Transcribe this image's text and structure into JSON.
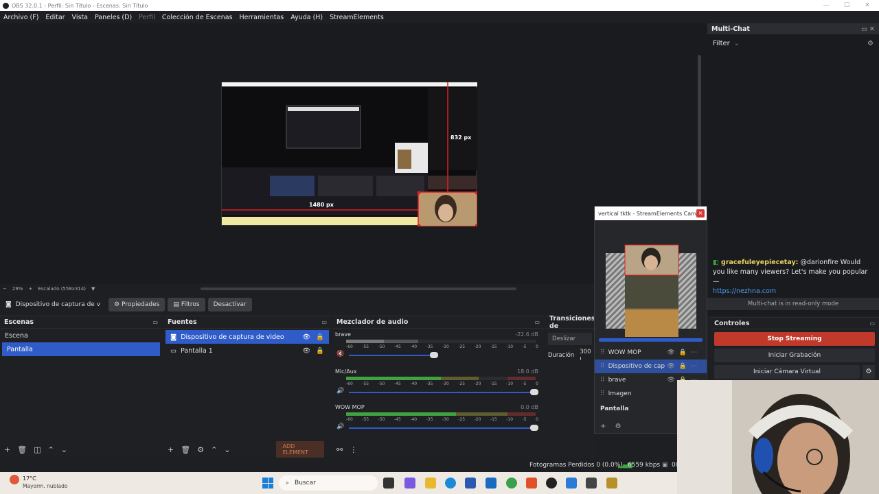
{
  "window": {
    "title": "OBS 32.0.1 - Perfil: Sin Título - Escenas: Sin Título"
  },
  "menu": [
    "Archivo (F)",
    "Editar",
    "Vista",
    "Paneles (D)",
    "Perfil",
    "Colección de Escenas",
    "Herramientas",
    "Ayuda (H)",
    "StreamElements"
  ],
  "preview": {
    "label_height": "832 px",
    "label_width": "1480 px"
  },
  "zoombar": {
    "minus": "−",
    "zoom": "29%",
    "plus": "+",
    "scale": "Escalado (558x314)"
  },
  "sourcebar": {
    "source": "Dispositivo de captura de v",
    "properties": "Propiedades",
    "filters": "Filtros",
    "deactivate": "Desactivar"
  },
  "scenes": {
    "title": "Escenas",
    "items": [
      "Escena",
      "Pantalla"
    ]
  },
  "sources": {
    "title": "Fuentes",
    "items": [
      "Dispositivo de captura de video",
      "Pantalla 1"
    ],
    "add_element": "ADD ELEMENT"
  },
  "mixer": {
    "title": "Mezclador de audio",
    "channels": [
      {
        "name": "brave",
        "db": "-22.6 dB"
      },
      {
        "name": "Mic/Aux",
        "db": "18.0 dB"
      },
      {
        "name": "WOW MOP",
        "db": "0.0 dB"
      }
    ],
    "ticks": [
      "-60",
      "-55",
      "-50",
      "-45",
      "-40",
      "-35",
      "-30",
      "-25",
      "-20",
      "-15",
      "-10",
      "-5",
      "0"
    ]
  },
  "transitions": {
    "title": "Transiciones de",
    "type": "Deslizar",
    "duration_label": "Duración",
    "duration": "300 ı"
  },
  "canvas_popup": {
    "title": "vertical tktk - StreamElements Canvas",
    "close": "×",
    "layers": [
      "WOW MOP",
      "Dispositivo de cap",
      "brave",
      "Imagen"
    ],
    "scene": "Pantalla"
  },
  "multichat": {
    "title": "Multi-Chat",
    "filter": "Filter",
    "message_user": "gracefuleyepiecetay:",
    "message_text": "@darionfire Would you like many viewers? Let's make you popular —",
    "message_link": "https://nezhna.com",
    "readonly": "Multi-chat is in read-only mode"
  },
  "controls": {
    "title": "Controles",
    "stop_streaming": "Stop Streaming",
    "start_recording": "Iniciar Grabación",
    "virtual_cam": "Iniciar Cámara Virtual"
  },
  "status": {
    "dropped_frames": "Fotogramas Perdidos 0 (0.0%)",
    "bitrate": "6559 kbps",
    "extra": "00"
  },
  "taskbar": {
    "temp": "17°C",
    "weather": "Mayorm. nublado",
    "search": "Buscar"
  },
  "colors": {
    "accent": "#2f5cc9",
    "stop": "#c0392b",
    "meter_green": "#3fa33f"
  }
}
